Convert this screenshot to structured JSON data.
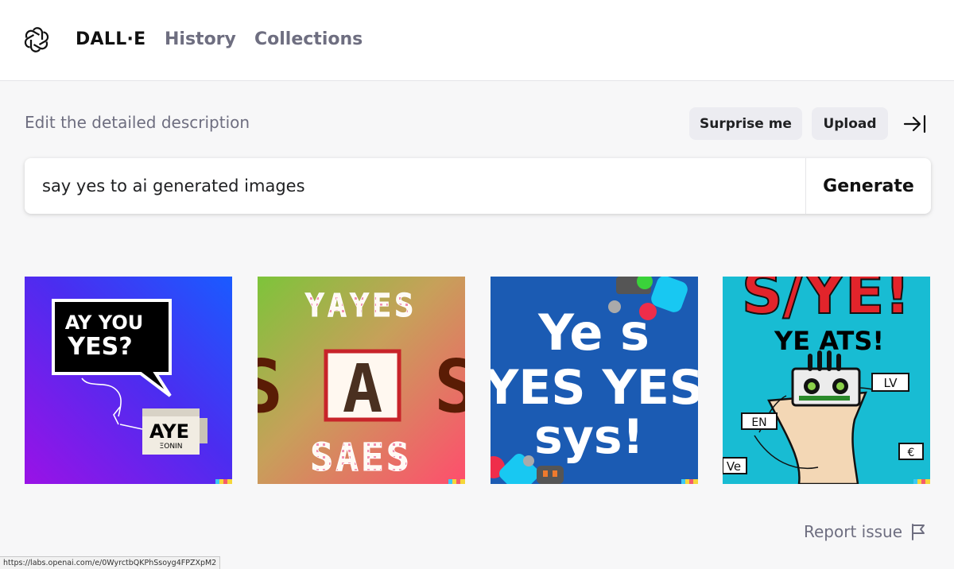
{
  "nav": {
    "brand": "DALL·E",
    "history": "History",
    "collections": "Collections",
    "logo_icon": "openai-logo-icon"
  },
  "prompt": {
    "label": "Edit the detailed description",
    "surprise_label": "Surprise me",
    "upload_label": "Upload",
    "collapse_icon": "arrow-right-to-bar-icon",
    "value": "say yes to ai generated images",
    "generate_label": "Generate"
  },
  "images": [
    {
      "alt": "generated-image-1",
      "bubble_text": [
        "AY YOU",
        "YES?"
      ],
      "mug_text": "AYE",
      "mug_sub": "ΞONIN"
    },
    {
      "alt": "generated-image-2",
      "top_text": "YAYES",
      "mid_text": "S A S",
      "bottom_text": "SAES"
    },
    {
      "alt": "generated-image-3",
      "lines": [
        "Ye s",
        "YES YES",
        "sys!"
      ]
    },
    {
      "alt": "generated-image-4",
      "top_text": "S/YE!",
      "sub_text": "YE ATS!",
      "tag_right": "LV",
      "tag_left": "EN",
      "tag_bottom_left": "Ve",
      "tag_bottom_right": "€"
    }
  ],
  "footer": {
    "report_label": "Report issue",
    "report_icon": "flag-icon",
    "status_url": "https://labs.openai.com/e/0WyrctbQKPhSsoyg4FPZXpM2"
  },
  "colors": {
    "background": "#f7f7f8",
    "muted_text": "#6e6e80",
    "pill_bg": "#ececf1"
  }
}
